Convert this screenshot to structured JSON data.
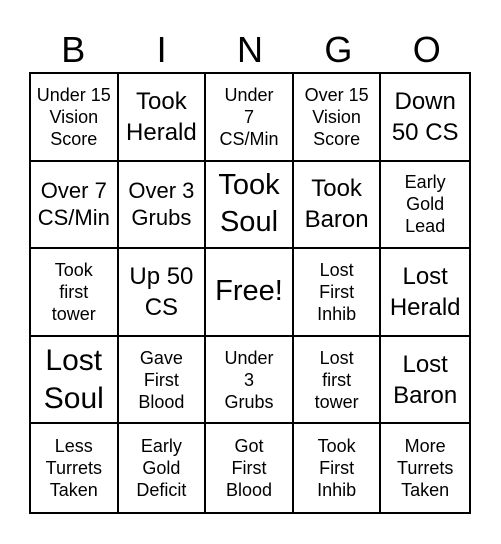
{
  "header": {
    "letters": [
      "B",
      "I",
      "N",
      "G",
      "O"
    ]
  },
  "cells": [
    {
      "lines": [
        "Under 15",
        "Vision",
        "Score"
      ],
      "size": "sm"
    },
    {
      "lines": [
        "Took",
        "Herald"
      ],
      "size": "md2"
    },
    {
      "lines": [
        "Under",
        "7",
        "CS/Min"
      ],
      "size": "sm"
    },
    {
      "lines": [
        "Over 15",
        "Vision",
        "Score"
      ],
      "size": "sm"
    },
    {
      "lines": [
        "Down",
        "50 CS"
      ],
      "size": "md2"
    },
    {
      "lines": [
        "Over 7",
        "CS/Min"
      ],
      "size": "md"
    },
    {
      "lines": [
        "Over 3",
        "Grubs"
      ],
      "size": "md"
    },
    {
      "lines": [
        "Took",
        "Soul"
      ],
      "size": "lg"
    },
    {
      "lines": [
        "Took",
        "Baron"
      ],
      "size": "md2"
    },
    {
      "lines": [
        "Early",
        "Gold",
        "Lead"
      ],
      "size": "sm"
    },
    {
      "lines": [
        "Took",
        "first",
        "tower"
      ],
      "size": "sm"
    },
    {
      "lines": [
        "Up 50",
        "CS"
      ],
      "size": "md2"
    },
    {
      "lines": [
        "Free!"
      ],
      "size": "lg"
    },
    {
      "lines": [
        "Lost",
        "First",
        "Inhib"
      ],
      "size": "sm"
    },
    {
      "lines": [
        "Lost",
        "Herald"
      ],
      "size": "md2"
    },
    {
      "lines": [
        "Lost",
        "Soul"
      ],
      "size": "xl"
    },
    {
      "lines": [
        "Gave",
        "First",
        "Blood"
      ],
      "size": "sm"
    },
    {
      "lines": [
        "Under",
        "3",
        "Grubs"
      ],
      "size": "sm"
    },
    {
      "lines": [
        "Lost",
        "first",
        "tower"
      ],
      "size": "sm"
    },
    {
      "lines": [
        "Lost",
        "Baron"
      ],
      "size": "md2"
    },
    {
      "lines": [
        "Less",
        "Turrets",
        "Taken"
      ],
      "size": "sm"
    },
    {
      "lines": [
        "Early",
        "Gold",
        "Deficit"
      ],
      "size": "sm"
    },
    {
      "lines": [
        "Got",
        "First",
        "Blood"
      ],
      "size": "sm"
    },
    {
      "lines": [
        "Took",
        "First",
        "Inhib"
      ],
      "size": "sm"
    },
    {
      "lines": [
        "More",
        "Turrets",
        "Taken"
      ],
      "size": "sm"
    }
  ]
}
